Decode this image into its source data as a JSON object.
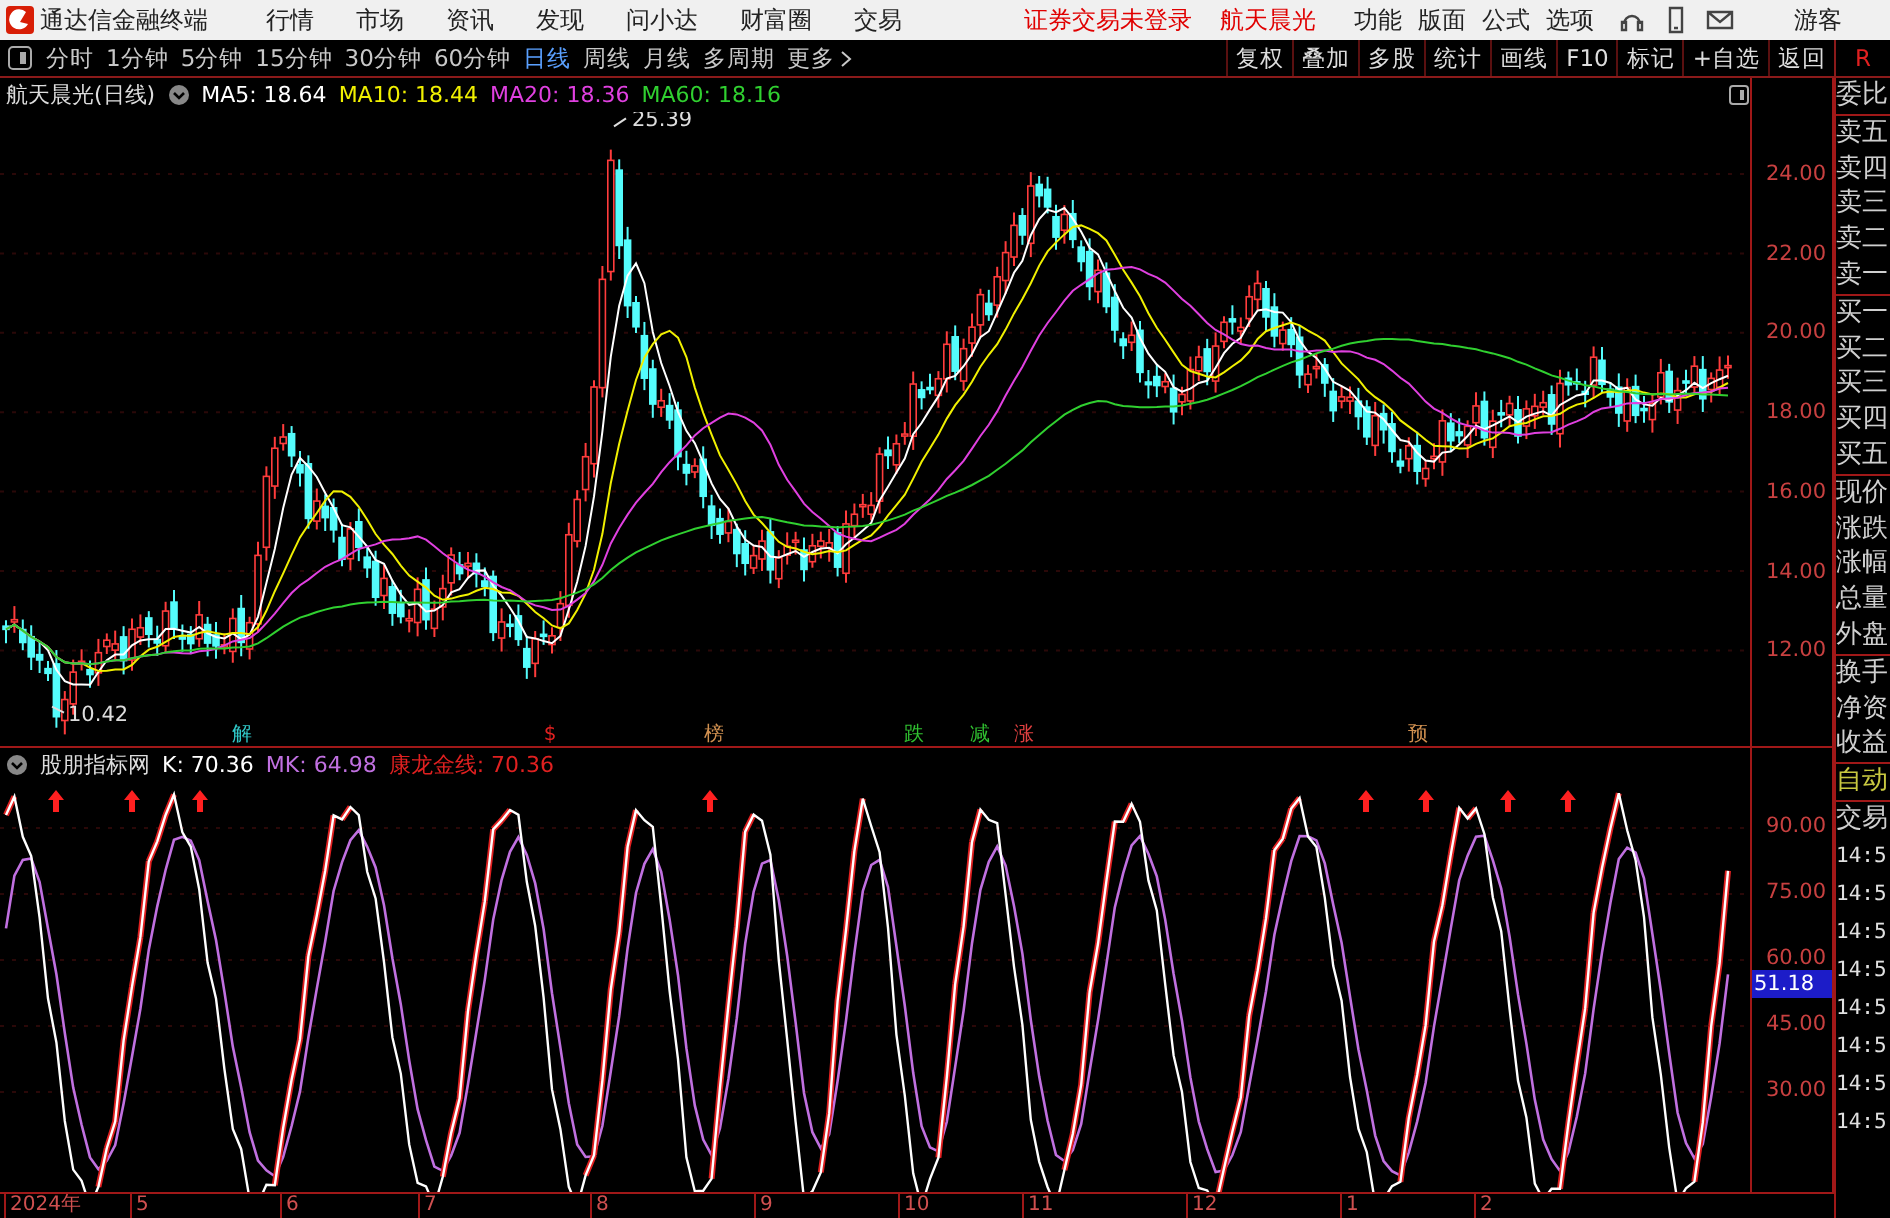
{
  "title_bar": {
    "app_name": "通达信金融终端",
    "menu": [
      "行情",
      "市场",
      "资讯",
      "发现",
      "问小达",
      "财富圈",
      "交易"
    ],
    "notice": "证券交易未登录",
    "stock": "航天晨光",
    "right_menu": [
      "功能",
      "版面",
      "公式",
      "选项"
    ],
    "user": "游客"
  },
  "toolbar": {
    "periods": [
      {
        "label": "分时",
        "selected": false
      },
      {
        "label": "1分钟",
        "selected": false
      },
      {
        "label": "5分钟",
        "selected": false
      },
      {
        "label": "15分钟",
        "selected": false
      },
      {
        "label": "30分钟",
        "selected": false
      },
      {
        "label": "60分钟",
        "selected": false
      },
      {
        "label": "日线",
        "selected": true
      },
      {
        "label": "周线",
        "selected": false
      },
      {
        "label": "月线",
        "selected": false
      },
      {
        "label": "多周期",
        "selected": false
      },
      {
        "label": "更多",
        "selected": false
      }
    ],
    "actions": [
      "复权",
      "叠加",
      "多股",
      "统计",
      "画线",
      "F10",
      "标记",
      "+自选",
      "返回"
    ],
    "corner": "R"
  },
  "price_pane": {
    "title": "航天晨光(日线)",
    "indicators": [
      {
        "name": "MA5:",
        "value": "18.64",
        "color": "#ffffff"
      },
      {
        "name": "MA10:",
        "value": "18.44",
        "color": "#f0f000"
      },
      {
        "name": "MA20:",
        "value": "18.36",
        "color": "#e040e0"
      },
      {
        "name": "MA60:",
        "value": "18.16",
        "color": "#30d030"
      }
    ],
    "high_label": "25.39",
    "low_label": "10.42",
    "markers": [
      {
        "text": "解",
        "color": "#30c8c8"
      },
      {
        "text": "$",
        "color": "#e02020"
      },
      {
        "text": "榜",
        "color": "#d09050"
      },
      {
        "text": "跌",
        "color": "#30c030"
      },
      {
        "text": "减",
        "color": "#30c030"
      },
      {
        "text": "涨",
        "color": "#e04040"
      },
      {
        "text": "预",
        "color": "#d09050"
      }
    ],
    "axis": [
      "24.00",
      "22.00",
      "20.00",
      "18.00",
      "16.00",
      "14.00",
      "12.00"
    ]
  },
  "indicator_pane": {
    "title": "股朋指标网",
    "values": [
      {
        "name": "K:",
        "value": "70.36",
        "color": "#ffffff"
      },
      {
        "name": "MK:",
        "value": "64.98",
        "color": "#c070e0"
      },
      {
        "name": "康龙金线:",
        "value": "70.36",
        "color": "#e02020"
      }
    ],
    "axis": [
      "90.00",
      "75.00",
      "60.00",
      "45.00",
      "30.00"
    ],
    "current_value": "51.18"
  },
  "time_axis": [
    "2024年",
    "5",
    "6",
    "7",
    "8",
    "9",
    "10",
    "11",
    "12",
    "1",
    "2"
  ],
  "side_panel": {
    "groups": [
      [
        "委比"
      ],
      [
        "卖五",
        "卖四",
        "卖三",
        "卖二",
        "卖一"
      ],
      [
        "买一",
        "买二",
        "买三",
        "买四",
        "买五"
      ],
      [
        "现价",
        "涨跌",
        "涨幅",
        "总量",
        "外盘"
      ],
      [
        "换手",
        "净资",
        "收益"
      ]
    ],
    "auto": "自动",
    "trade": "交易",
    "times": [
      "14:5",
      "14:5",
      "14:5",
      "14:5",
      "14:5",
      "14:5",
      "14:5",
      "14:5"
    ]
  }
}
